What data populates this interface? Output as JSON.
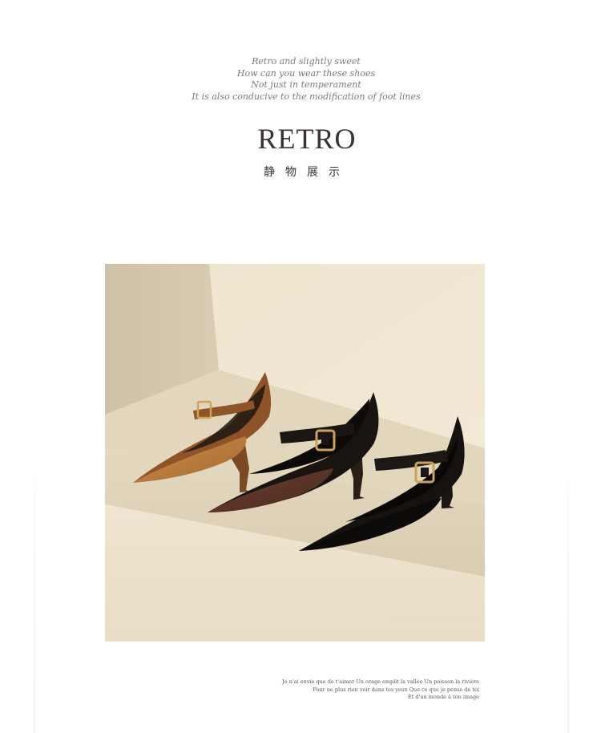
{
  "intro_lines": [
    "Retro and slightly sweet",
    "How can you wear these shoes",
    "Not just in temperament",
    "It is also conducive to the modification of foot lines"
  ],
  "title": "RETRO",
  "subtitle": "静物展示",
  "caption_lines": [
    "Je n'ai envie que de t'aimer Un orage emplit la vallée Un poisson la rivière",
    "Pour ne plus rien voir dans tes yeux Que ce que je pense de toi",
    "Et d'un monde à ton image"
  ],
  "photo": {
    "subject": "three pointed-toe mary-jane kitten heels with buckle straps",
    "colors": {
      "background_wall": "#ede3cd",
      "floor": "#e8ddc4",
      "tan_suede": "#b77b3e",
      "brown_suede": "#5a3526",
      "black_suede": "#151210",
      "buckle_gold": "#c9a45a"
    }
  }
}
